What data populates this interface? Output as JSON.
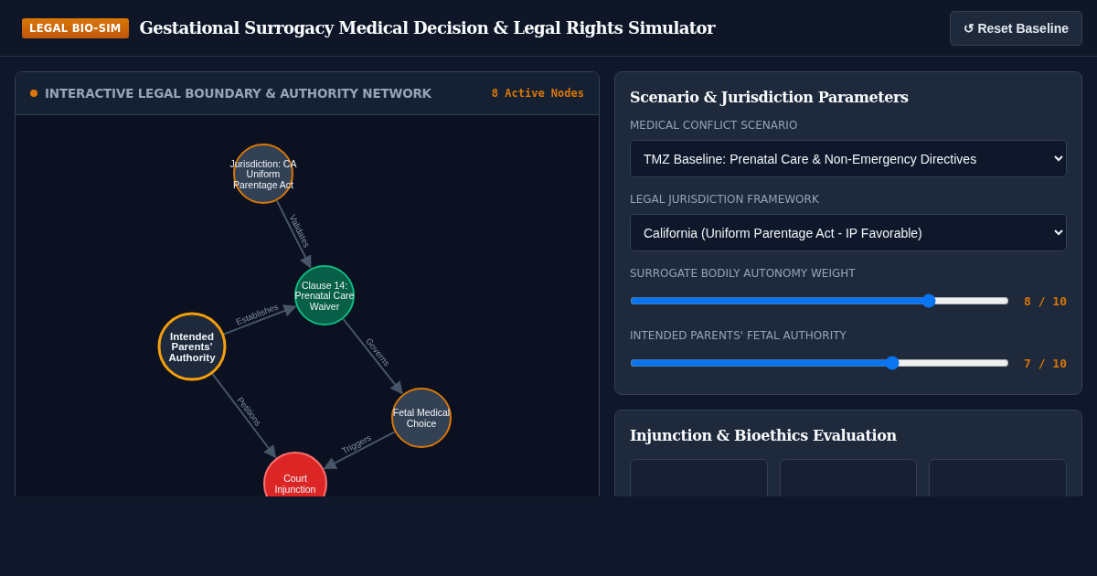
{
  "header": {
    "badge": "LEGAL BIO-SIM",
    "title": "Gestational Surrogacy Medical Decision & Legal Rights Simulator",
    "reset_button": "↺ Reset Baseline"
  },
  "network": {
    "title": "INTERACTIVE LEGAL BOUNDARY & AUTHORITY NETWORK",
    "count": "8 Active Nodes",
    "nodes": [
      {
        "kind": "jurisdiction",
        "lines": [
          "Jurisdiction: CA",
          "Uniform",
          "Parentage Act"
        ]
      },
      {
        "kind": "clause",
        "lines": [
          "Clause 14:",
          "Prenatal Care",
          "Waiver"
        ]
      },
      {
        "kind": "authority",
        "lines": [
          "Intended",
          "Parents'",
          "Authority"
        ]
      },
      {
        "kind": "choice",
        "lines": [
          "Fetal Medical",
          "Choice"
        ]
      },
      {
        "kind": "threshold",
        "lines": [
          "Court",
          "Injunction"
        ]
      }
    ],
    "edges": [
      {
        "label": "Validates"
      },
      {
        "label": "Establishes"
      },
      {
        "label": "Governs"
      },
      {
        "label": "Petitions"
      },
      {
        "label": "Triggers"
      }
    ]
  },
  "parameters": {
    "title": "Scenario & Jurisdiction Parameters",
    "controls": [
      {
        "kind": "select",
        "label": "MEDICAL CONFLICT SCENARIO",
        "value": "TMZ Baseline: Prenatal Care & Non-Emergency Directives"
      },
      {
        "kind": "select",
        "label": "LEGAL JURISDICTION FRAMEWORK",
        "value": "California (Uniform Parentage Act - IP Favorable)"
      },
      {
        "kind": "slider",
        "label": "SURROGATE BODILY AUTONOMY WEIGHT",
        "level": 0.8,
        "reading": "8 / 10"
      },
      {
        "kind": "slider",
        "label": "INTENDED PARENTS' FETAL AUTHORITY",
        "level": 0.7,
        "reading": "7 / 10"
      }
    ]
  },
  "evaluation": {
    "title": "Injunction & Bioethics Evaluation",
    "cards": [
      {
        "kind": "card"
      },
      {
        "kind": "card"
      },
      {
        "kind": "card"
      }
    ]
  }
}
